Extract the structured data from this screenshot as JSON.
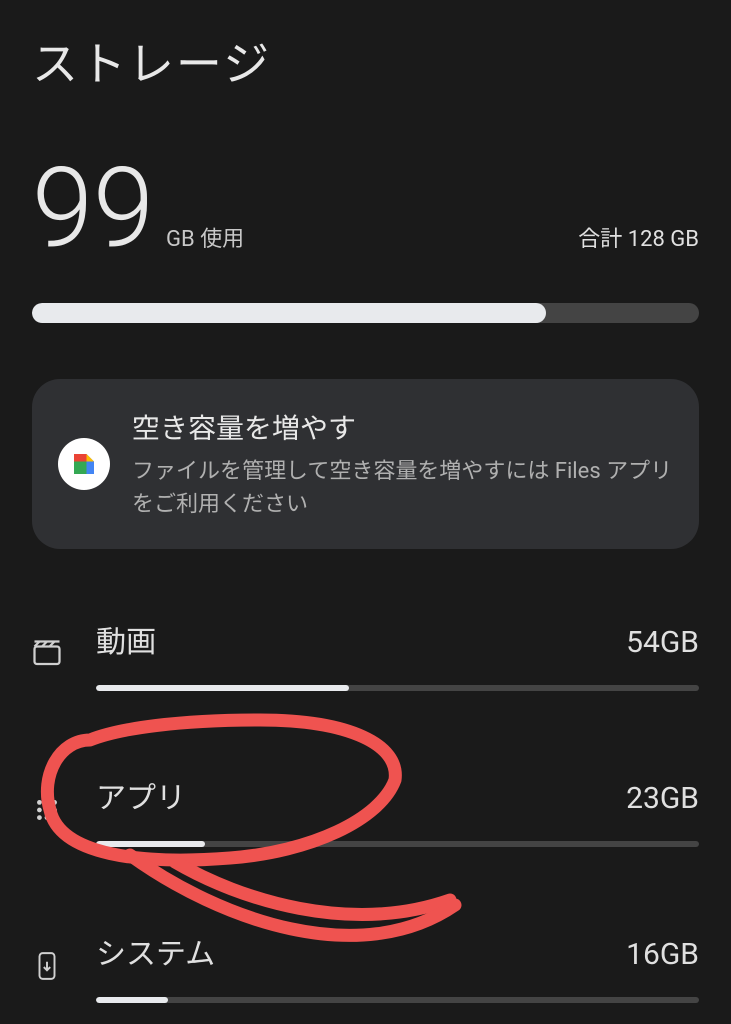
{
  "page": {
    "title": "ストレージ"
  },
  "usage": {
    "value": "99",
    "unit_label": "GB 使用",
    "total_label": "合計 128 GB",
    "percent": 77
  },
  "card": {
    "title": "空き容量を増やす",
    "description": "ファイルを管理して空き容量を増やすには Files アプリをご利用ください"
  },
  "categories": [
    {
      "label": "動画",
      "size": "54GB",
      "percent": 42
    },
    {
      "label": "アプリ",
      "size": "23GB",
      "percent": 18
    },
    {
      "label": "システム",
      "size": "16GB",
      "percent": 12
    }
  ]
}
